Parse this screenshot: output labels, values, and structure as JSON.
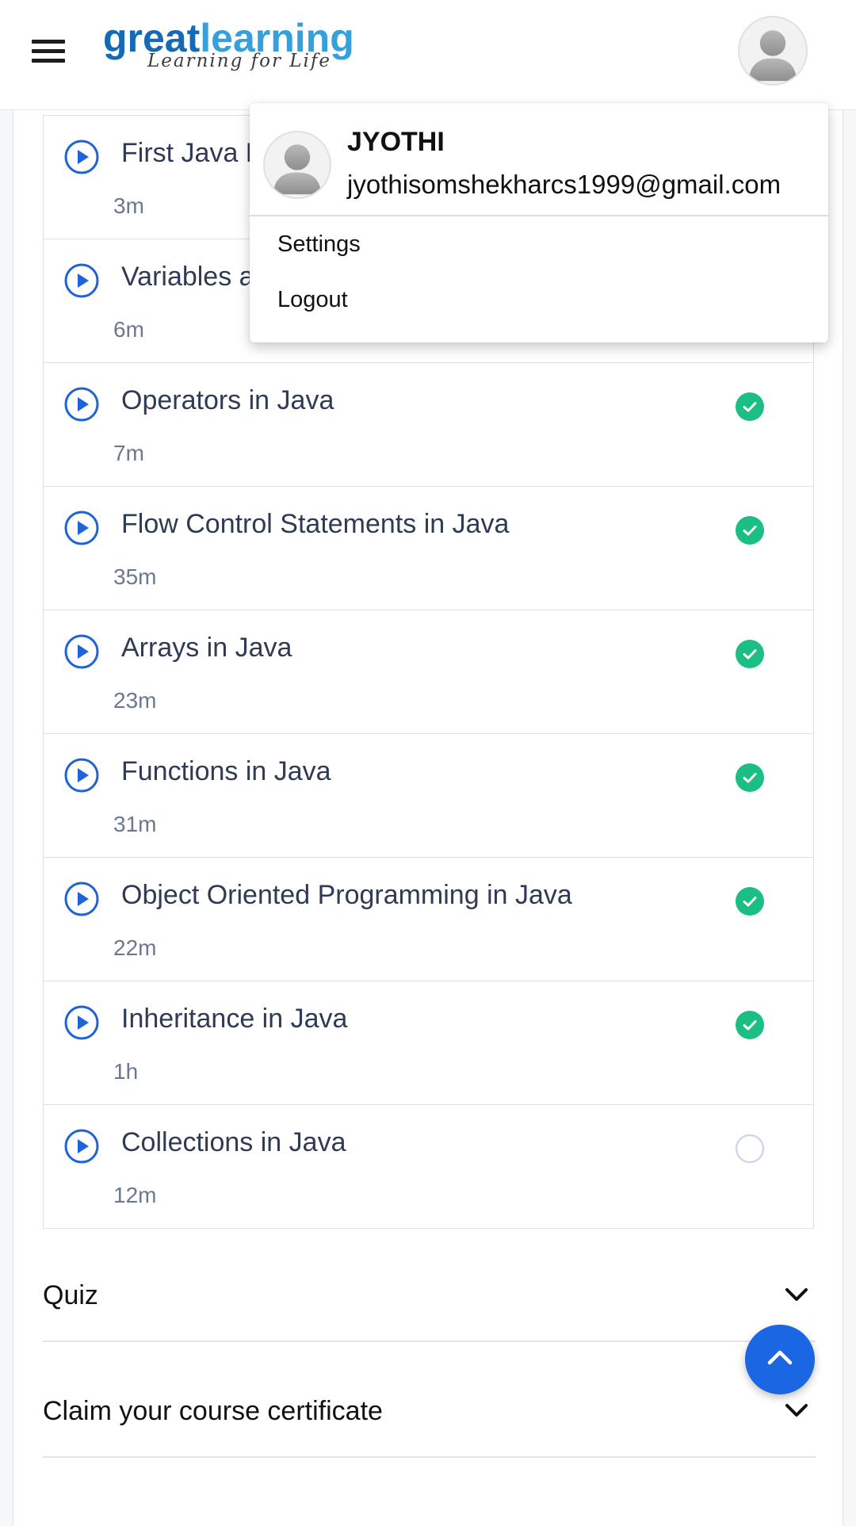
{
  "header": {
    "brand_part1": "great",
    "brand_part2": "learning",
    "tagline": "Learning for Life",
    "menu_icon": "hamburger-menu-icon",
    "avatar_icon": "user-avatar-icon"
  },
  "lessons": [
    {
      "title": "First Java Program",
      "duration": "3m",
      "status": "completed"
    },
    {
      "title": "Variables and Data Types in Java",
      "duration": "6m",
      "status": "completed"
    },
    {
      "title": "Operators in Java",
      "duration": "7m",
      "status": "completed"
    },
    {
      "title": "Flow Control Statements in Java",
      "duration": "35m",
      "status": "completed"
    },
    {
      "title": "Arrays in Java",
      "duration": "23m",
      "status": "completed"
    },
    {
      "title": "Functions in Java",
      "duration": "31m",
      "status": "completed"
    },
    {
      "title": "Object Oriented Programming in Java",
      "duration": "22m",
      "status": "completed"
    },
    {
      "title": "Inheritance in Java",
      "duration": "1h",
      "status": "completed"
    },
    {
      "title": "Collections in Java",
      "duration": "12m",
      "status": "not-started"
    }
  ],
  "sections": {
    "quiz": "Quiz",
    "certificate": "Claim your course certificate"
  },
  "profile_menu": {
    "name": "JYOTHI",
    "email": "jyothisomshekharcs1999@gmail.com",
    "settings": "Settings",
    "logout": "Logout"
  },
  "colors": {
    "brand_dark": "#1669b6",
    "brand_light": "#36a0dc",
    "play_blue": "#1f63d6",
    "check_green": "#1bbf83",
    "fab_blue": "#1b66e3"
  },
  "icons": {
    "play": "play-circle-icon",
    "complete": "check-circle-icon",
    "incomplete": "empty-circle-icon",
    "expand": "chevron-down-icon",
    "scroll_top": "chevron-up-icon"
  }
}
